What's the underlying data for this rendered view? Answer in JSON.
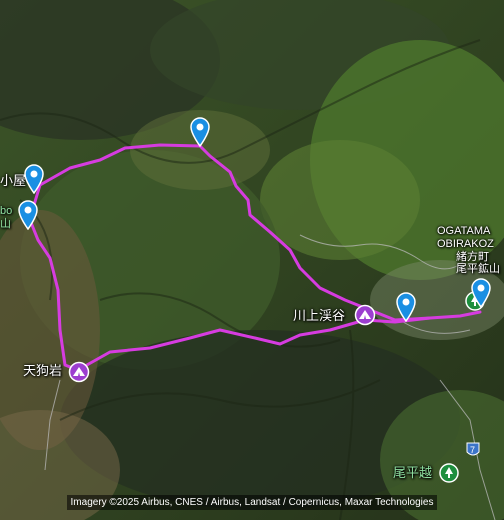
{
  "map": {
    "labels": {
      "hut_partial": "小屋",
      "left_partial_1": "bo",
      "left_partial_2": "山",
      "obirakoz_line1": "OGATAMA",
      "obirakoz_line2": "OBIRAKOZ",
      "obirakoz_line3": "緒方町",
      "obirakoz_line4": "尾平鉱山",
      "kawakami": "川上渓谷",
      "tengu": "天狗岩",
      "ohiragoe": "尾平越",
      "road_number": "7"
    },
    "attribution": "Imagery ©2025 Airbus, CNES / Airbus, Landsat / Copernicus, Maxar Technologies",
    "colors": {
      "route": "#d63ce0",
      "pin": "#1a8fe3",
      "poi": "#9c3ecf",
      "poi_green": "#1e8e3e"
    },
    "markers": [
      {
        "icon": "location-pin-icon"
      },
      {
        "icon": "location-pin-icon"
      },
      {
        "icon": "location-pin-icon"
      },
      {
        "icon": "location-pin-icon"
      },
      {
        "icon": "location-pin-icon"
      },
      {
        "icon": "tent-poi-icon"
      },
      {
        "icon": "tent-poi-icon"
      },
      {
        "icon": "park-poi-icon"
      }
    ]
  }
}
